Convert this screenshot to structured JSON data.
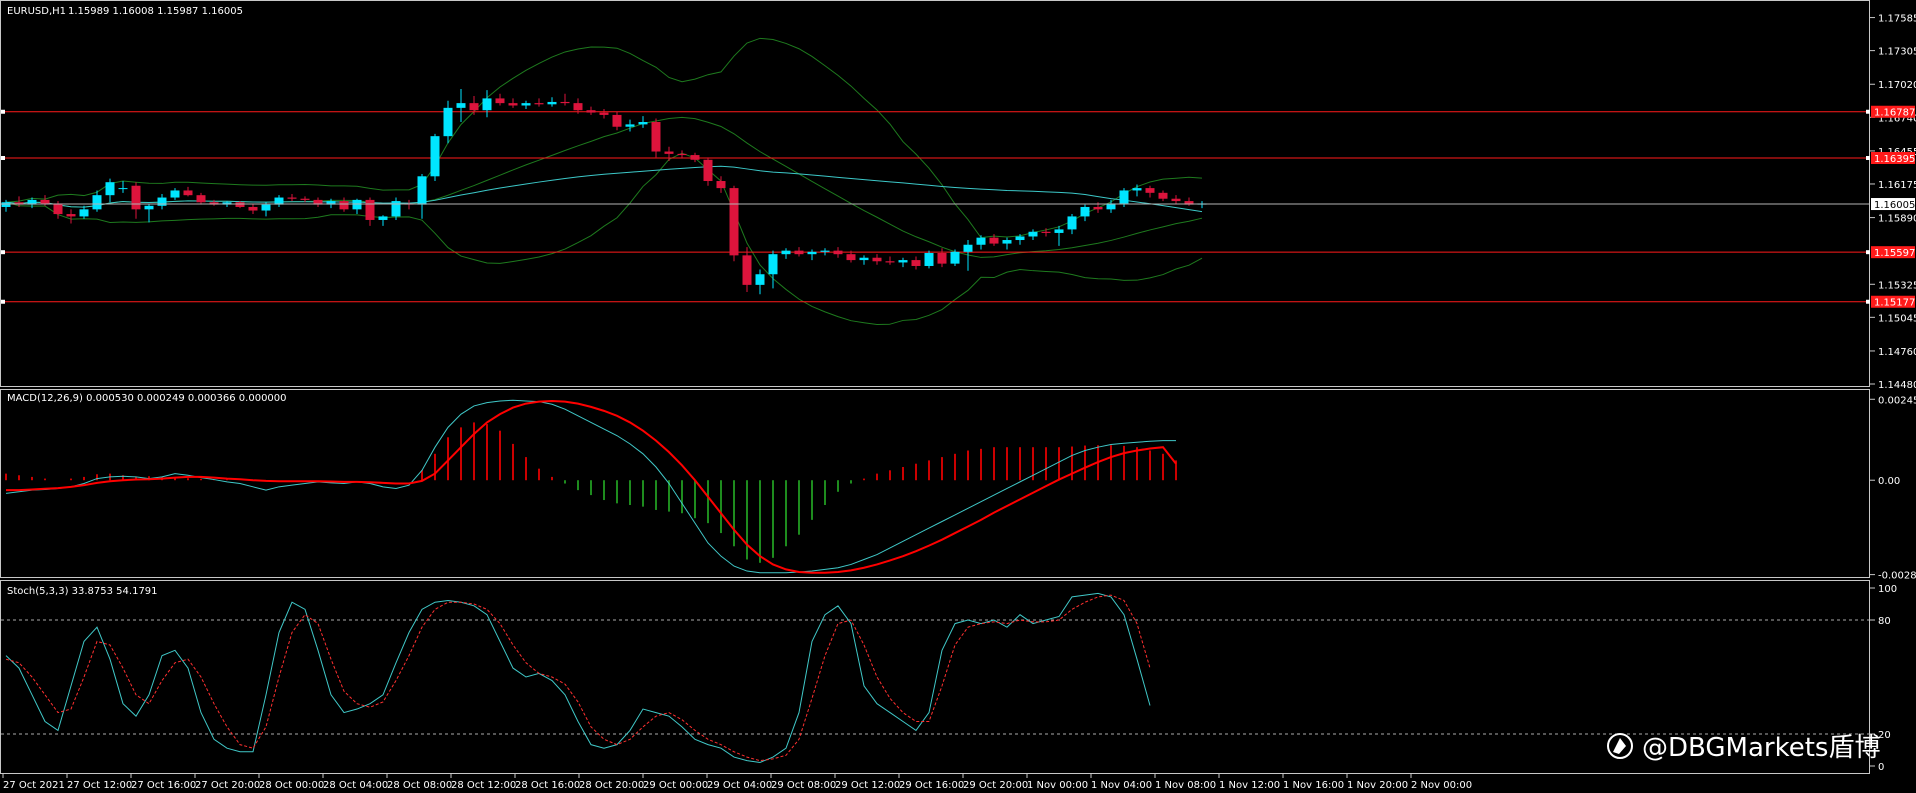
{
  "header": {
    "symbol": "EURUSD,H1",
    "ohlc": "1.15989 1.16008 1.15987 1.16005"
  },
  "watermark": "@DBGMarkets盾博",
  "colors": {
    "bull": "#00e5ff",
    "bear": "#dc143c",
    "bands": "#1e7a1e",
    "ma": "#3cc8c8",
    "hline": "#ff1a1a",
    "macd_main": "#40c8c8",
    "macd_signal": "#ff0000",
    "hist_pos": "#cc0000",
    "hist_neg": "#1e8c1e",
    "stoch_main": "#40c8c8",
    "stoch_signal": "#ff3030"
  },
  "chart_data": [
    {
      "type": "candlestick",
      "panel": "price",
      "price_axis_ticks": [
        "1.17585",
        "1.17305",
        "1.17020",
        "1.16740",
        "1.16455",
        "1.16175",
        "1.15890",
        "1.15325",
        "1.15045",
        "1.14760",
        "1.14480"
      ],
      "current_price": "1.16005",
      "horizontal_levels": [
        {
          "value": 1.16787,
          "label": "1.16787"
        },
        {
          "value": 1.16395,
          "label": "1.16395"
        },
        {
          "value": 1.15597,
          "label": "1.15597"
        },
        {
          "value": 1.15177,
          "label": "1.15177"
        }
      ],
      "ylim": [
        1.1448,
        1.177
      ],
      "x_labels": [
        "27 Oct 2021",
        "27 Oct 12:00",
        "27 Oct 16:00",
        "27 Oct 20:00",
        "28 Oct 00:00",
        "28 Oct 04:00",
        "28 Oct 08:00",
        "28 Oct 12:00",
        "28 Oct 16:00",
        "28 Oct 20:00",
        "29 Oct 00:00",
        "29 Oct 04:00",
        "29 Oct 08:00",
        "29 Oct 12:00",
        "29 Oct 16:00",
        "29 Oct 20:00",
        "1 Nov 00:00",
        "1 Nov 04:00",
        "1 Nov 08:00",
        "1 Nov 12:00",
        "1 Nov 16:00",
        "1 Nov 20:00",
        "2 Nov 00:00"
      ],
      "candles": [
        [
          1.1598,
          1.1604,
          1.1594,
          1.1602
        ],
        [
          1.1602,
          1.1607,
          1.1598,
          1.16
        ],
        [
          1.16,
          1.1606,
          1.1597,
          1.1604
        ],
        [
          1.1604,
          1.1608,
          1.1599,
          1.1601
        ],
        [
          1.1601,
          1.1603,
          1.1588,
          1.1592
        ],
        [
          1.1592,
          1.1596,
          1.1584,
          1.159
        ],
        [
          1.159,
          1.1599,
          1.1588,
          1.1596
        ],
        [
          1.1596,
          1.1612,
          1.1594,
          1.1608
        ],
        [
          1.1608,
          1.1622,
          1.1602,
          1.1619
        ],
        [
          1.1614,
          1.162,
          1.161,
          1.1614
        ],
        [
          1.1616,
          1.1619,
          1.1588,
          1.1596
        ],
        [
          1.1596,
          1.1601,
          1.1585,
          1.1599
        ],
        [
          1.1599,
          1.1609,
          1.1596,
          1.1606
        ],
        [
          1.1606,
          1.1614,
          1.1604,
          1.1612
        ],
        [
          1.1612,
          1.1615,
          1.1607,
          1.1608
        ],
        [
          1.1608,
          1.161,
          1.16,
          1.1602
        ],
        [
          1.1602,
          1.1604,
          1.1599,
          1.16
        ],
        [
          1.16,
          1.1603,
          1.1598,
          1.1602
        ],
        [
          1.1602,
          1.1603,
          1.1597,
          1.1598
        ],
        [
          1.1598,
          1.1601,
          1.1592,
          1.1595
        ],
        [
          1.1595,
          1.1602,
          1.159,
          1.16
        ],
        [
          1.16,
          1.1608,
          1.1598,
          1.1606
        ],
        [
          1.1606,
          1.1609,
          1.1603,
          1.1605
        ],
        [
          1.1605,
          1.1607,
          1.1602,
          1.1604
        ],
        [
          1.1604,
          1.1606,
          1.1598,
          1.16
        ],
        [
          1.16,
          1.1605,
          1.1597,
          1.1603
        ],
        [
          1.1603,
          1.1606,
          1.1594,
          1.1596
        ],
        [
          1.1596,
          1.1605,
          1.1592,
          1.1604
        ],
        [
          1.1604,
          1.1606,
          1.1582,
          1.1587
        ],
        [
          1.1587,
          1.1591,
          1.1582,
          1.159
        ],
        [
          1.159,
          1.1606,
          1.1587,
          1.1603
        ],
        [
          1.1601,
          1.1604,
          1.1596,
          1.16
        ],
        [
          1.16,
          1.1626,
          1.1588,
          1.1624
        ],
        [
          1.1624,
          1.166,
          1.162,
          1.1658
        ],
        [
          1.1658,
          1.1688,
          1.1652,
          1.1682
        ],
        [
          1.1682,
          1.1698,
          1.167,
          1.1686
        ],
        [
          1.1686,
          1.1692,
          1.1676,
          1.168
        ],
        [
          1.168,
          1.1697,
          1.1674,
          1.169
        ],
        [
          1.169,
          1.1694,
          1.1684,
          1.1686
        ],
        [
          1.1686,
          1.169,
          1.1682,
          1.1684
        ],
        [
          1.1684,
          1.1688,
          1.1681,
          1.1686
        ],
        [
          1.1686,
          1.169,
          1.1683,
          1.1685
        ],
        [
          1.1685,
          1.1691,
          1.1683,
          1.1687
        ],
        [
          1.1687,
          1.1694,
          1.1684,
          1.1686
        ],
        [
          1.1686,
          1.169,
          1.1677,
          1.168
        ],
        [
          1.168,
          1.1683,
          1.1676,
          1.1678
        ],
        [
          1.1678,
          1.1681,
          1.1673,
          1.1676
        ],
        [
          1.1676,
          1.1679,
          1.1663,
          1.1666
        ],
        [
          1.1666,
          1.1672,
          1.1662,
          1.1668
        ],
        [
          1.1668,
          1.1675,
          1.1665,
          1.167
        ],
        [
          1.167,
          1.1673,
          1.164,
          1.1645
        ],
        [
          1.1645,
          1.1649,
          1.1637,
          1.1643
        ],
        [
          1.1643,
          1.1646,
          1.1639,
          1.1642
        ],
        [
          1.1642,
          1.1644,
          1.1636,
          1.1638
        ],
        [
          1.1638,
          1.164,
          1.1616,
          1.162
        ],
        [
          1.162,
          1.1624,
          1.161,
          1.1614
        ],
        [
          1.1614,
          1.1616,
          1.1552,
          1.1557
        ],
        [
          1.1557,
          1.1564,
          1.1526,
          1.1532
        ],
        [
          1.1532,
          1.1545,
          1.1524,
          1.1541
        ],
        [
          1.1541,
          1.1561,
          1.1529,
          1.1558
        ],
        [
          1.1558,
          1.1563,
          1.1554,
          1.1561
        ],
        [
          1.1561,
          1.1564,
          1.1556,
          1.1558
        ],
        [
          1.1558,
          1.1562,
          1.1553,
          1.156
        ],
        [
          1.156,
          1.1563,
          1.1557,
          1.1561
        ],
        [
          1.1561,
          1.1564,
          1.1555,
          1.1558
        ],
        [
          1.1558,
          1.1561,
          1.1551,
          1.1553
        ],
        [
          1.1553,
          1.1557,
          1.1549,
          1.1555
        ],
        [
          1.1555,
          1.1558,
          1.1549,
          1.1552
        ],
        [
          1.1552,
          1.1556,
          1.1549,
          1.1551
        ],
        [
          1.1551,
          1.1555,
          1.1547,
          1.1553
        ],
        [
          1.1553,
          1.1556,
          1.1545,
          1.1548
        ],
        [
          1.1548,
          1.1561,
          1.1546,
          1.1559
        ],
        [
          1.1559,
          1.1563,
          1.1547,
          1.155
        ],
        [
          1.155,
          1.1562,
          1.1548,
          1.156
        ],
        [
          1.156,
          1.157,
          1.1544,
          1.1566
        ],
        [
          1.1566,
          1.1574,
          1.1562,
          1.1572
        ],
        [
          1.1572,
          1.1575,
          1.1565,
          1.1567
        ],
        [
          1.1567,
          1.1572,
          1.1562,
          1.157
        ],
        [
          1.157,
          1.1575,
          1.1566,
          1.1573
        ],
        [
          1.1573,
          1.1579,
          1.157,
          1.1577
        ],
        [
          1.1577,
          1.158,
          1.1573,
          1.1576
        ],
        [
          1.1576,
          1.1582,
          1.1565,
          1.1579
        ],
        [
          1.1579,
          1.1592,
          1.1575,
          1.159
        ],
        [
          1.159,
          1.16,
          1.1586,
          1.1598
        ],
        [
          1.1598,
          1.1602,
          1.1593,
          1.1596
        ],
        [
          1.1596,
          1.1604,
          1.1593,
          1.1601
        ],
        [
          1.1601,
          1.1614,
          1.1598,
          1.1612
        ],
        [
          1.1612,
          1.1617,
          1.1607,
          1.1614
        ],
        [
          1.1614,
          1.1616,
          1.1606,
          1.161
        ],
        [
          1.161,
          1.1612,
          1.1603,
          1.1605
        ],
        [
          1.1605,
          1.1608,
          1.1601,
          1.1603
        ],
        [
          1.1603,
          1.1606,
          1.1599,
          1.16
        ],
        [
          1.16,
          1.1603,
          1.1597,
          1.1601
        ]
      ]
    },
    {
      "type": "line",
      "panel": "macd",
      "title": "MACD(12,26,9) 0.000530 0.000249 0.000366 0.000000",
      "axis_ticks": [
        "0.002451",
        "0.00",
        "-0.002858"
      ],
      "ylim": [
        -0.0029,
        0.00255
      ],
      "histogram": [
        0.0002,
        0.00015,
        0.0001,
        5e-05,
        0.0,
        5e-05,
        0.0001,
        0.00018,
        0.0002,
        0.00015,
        0.0001,
        0.00012,
        0.0001,
        8e-05,
        6e-05,
        4e-05,
        2e-05,
        2e-05,
        0.0,
        0.0,
        0.0,
        0.0,
        0.0,
        0.0,
        0.0,
        0.0,
        0.0,
        0.0,
        0.0,
        0.0,
        0.0,
        0.0,
        0.0003,
        0.0008,
        0.0013,
        0.0016,
        0.00175,
        0.0017,
        0.0015,
        0.0011,
        0.0007,
        0.00035,
        0.0001,
        -0.0001,
        -0.0003,
        -0.00045,
        -0.0006,
        -0.0007,
        -0.00075,
        -0.0008,
        -0.0009,
        -0.00095,
        -0.001,
        -0.00115,
        -0.0013,
        -0.0016,
        -0.002,
        -0.0024,
        -0.0025,
        -0.00235,
        -0.002,
        -0.00165,
        -0.0012,
        -0.00075,
        -0.00035,
        -0.0001,
        5e-05,
        0.0002,
        0.0003,
        0.0004,
        0.0005,
        0.0006,
        0.0007,
        0.0008,
        0.0009,
        0.00095,
        0.001,
        0.001,
        0.001,
        0.001,
        0.001,
        0.001,
        0.00102,
        0.00105,
        0.00106,
        0.00106,
        0.00104,
        0.001,
        0.0009,
        0.0008,
        0.0006
      ],
      "series": [
        {
          "values": [
            -0.0004,
            -0.00035,
            -0.0003,
            -0.00028,
            -0.00025,
            -0.0002,
            -0.0001,
            5e-05,
            0.0001,
            0.00012,
            0.0001,
            5e-05,
            0.0001,
            0.0002,
            0.00015,
            8e-05,
            2e-05,
            -5e-05,
            -0.0001,
            -0.0002,
            -0.0003,
            -0.0002,
            -0.00015,
            -0.0001,
            -5e-05,
            -8e-05,
            -0.0001,
            -5e-05,
            -0.0001,
            -0.0002,
            -0.00025,
            -0.00015,
            0.0003,
            0.001,
            0.0016,
            0.002,
            0.00225,
            0.00235,
            0.0024,
            0.00242,
            0.0024,
            0.00238,
            0.0023,
            0.00215,
            0.00195,
            0.00175,
            0.00155,
            0.00135,
            0.0011,
            0.0008,
            0.0004,
            -0.0001,
            -0.0007,
            -0.0013,
            -0.0019,
            -0.0023,
            -0.0026,
            -0.00275,
            -0.0028,
            -0.0028,
            -0.0028,
            -0.00278,
            -0.00275,
            -0.0027,
            -0.00265,
            -0.00255,
            -0.0024,
            -0.00225,
            -0.00205,
            -0.00185,
            -0.00165,
            -0.00145,
            -0.00125,
            -0.00105,
            -0.00085,
            -0.00065,
            -0.00045,
            -0.00025,
            -5e-05,
            0.00015,
            0.00035,
            0.00055,
            0.00075,
            0.0009,
            0.001,
            0.00108,
            0.00112,
            0.00115,
            0.00118,
            0.0012,
            0.0012
          ]
        },
        {
          "values": [
            -0.0003,
            -0.0003,
            -0.00028,
            -0.00026,
            -0.00024,
            -0.0002,
            -0.00015,
            -8e-05,
            -3e-05,
            0.0,
            2e-05,
            3e-05,
            5e-05,
            8e-05,
            0.0001,
            0.0001,
            8e-05,
            5e-05,
            3e-05,
            0.0,
            -2e-05,
            -3e-05,
            -3e-05,
            -3e-05,
            -3e-05,
            -4e-05,
            -5e-05,
            -5e-05,
            -6e-05,
            -8e-05,
            -0.0001,
            -0.0001,
            -2e-05,
            0.0002,
            0.0006,
            0.001,
            0.0014,
            0.00175,
            0.002,
            0.0022,
            0.00232,
            0.00238,
            0.0024,
            0.00238,
            0.00232,
            0.00222,
            0.0021,
            0.00195,
            0.00175,
            0.0015,
            0.0012,
            0.00085,
            0.00045,
            0.0,
            -0.0005,
            -0.001,
            -0.0015,
            -0.00195,
            -0.0023,
            -0.00255,
            -0.0027,
            -0.00278,
            -0.0028,
            -0.0028,
            -0.00278,
            -0.00273,
            -0.00265,
            -0.00255,
            -0.00243,
            -0.0023,
            -0.00215,
            -0.00198,
            -0.0018,
            -0.0016,
            -0.0014,
            -0.0012,
            -0.00098,
            -0.00078,
            -0.00058,
            -0.00038,
            -0.00018,
            2e-05,
            0.0002,
            0.00038,
            0.00055,
            0.0007,
            0.00082,
            0.0009,
            0.00096,
            0.001,
            0.0005
          ]
        }
      ]
    },
    {
      "type": "line",
      "panel": "stochastic",
      "title": "Stoch(5,3,3) 33.8753 54.1791",
      "axis_ticks": [
        "100",
        "80",
        "20",
        "0"
      ],
      "ylim": [
        0,
        100
      ],
      "series": [
        {
          "values": [
            62,
            55,
            40,
            25,
            20,
            45,
            70,
            78,
            60,
            35,
            28,
            40,
            62,
            65,
            55,
            30,
            15,
            10,
            8,
            8,
            40,
            75,
            92,
            88,
            65,
            40,
            30,
            32,
            35,
            40,
            58,
            75,
            88,
            92,
            93,
            92,
            90,
            85,
            70,
            55,
            50,
            52,
            48,
            40,
            25,
            12,
            10,
            12,
            20,
            32,
            30,
            28,
            22,
            15,
            12,
            10,
            5,
            3,
            2,
            5,
            10,
            30,
            70,
            85,
            90,
            80,
            45,
            35,
            30,
            25,
            20,
            30,
            65,
            80,
            82,
            80,
            82,
            78,
            85,
            80,
            82,
            84,
            95,
            96,
            97,
            95,
            85,
            60,
            34
          ]
        },
        {
          "values": [
            60,
            58,
            50,
            40,
            30,
            32,
            50,
            70,
            68,
            55,
            40,
            35,
            48,
            58,
            60,
            50,
            35,
            22,
            12,
            10,
            22,
            50,
            75,
            85,
            80,
            60,
            42,
            35,
            33,
            36,
            48,
            62,
            78,
            88,
            92,
            92,
            91,
            88,
            80,
            68,
            58,
            52,
            50,
            46,
            36,
            22,
            15,
            12,
            15,
            22,
            28,
            30,
            26,
            20,
            15,
            12,
            8,
            5,
            3,
            4,
            6,
            15,
            38,
            62,
            80,
            82,
            68,
            50,
            38,
            30,
            25,
            25,
            45,
            68,
            78,
            80,
            81,
            80,
            82,
            81,
            81,
            82,
            88,
            92,
            95,
            96,
            93,
            80,
            55
          ]
        }
      ]
    }
  ]
}
